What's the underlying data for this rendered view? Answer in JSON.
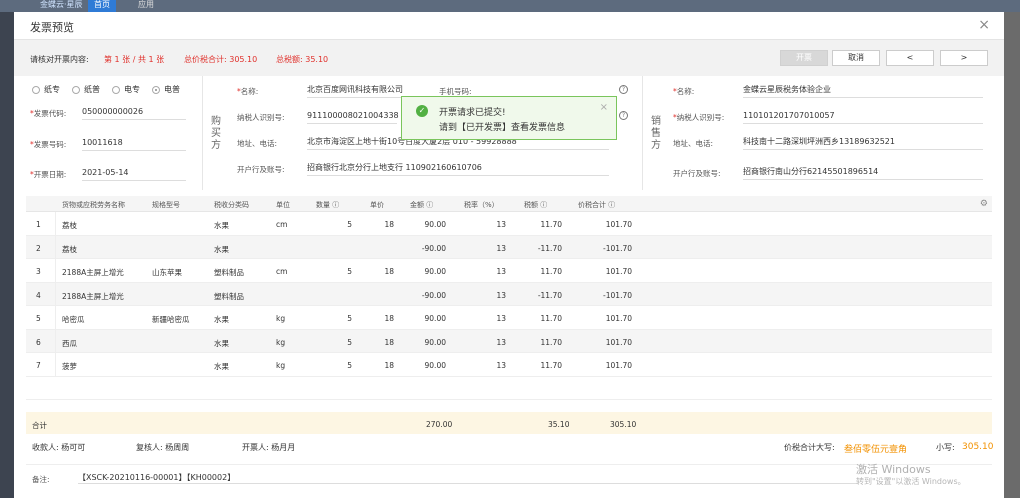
{
  "background": {
    "brand": "金蝶云·星辰",
    "tabs": [
      "首页",
      "应用"
    ]
  },
  "modal": {
    "title": "发票预览",
    "close_label": "×"
  },
  "toolbar": {
    "review_label": "请核对开票内容:",
    "page_info": "第 1 张 / 共 1 张",
    "total_with_tax_label": "总价税合计: 305.10",
    "total_tax_label": "总税额: 35.10",
    "issue_button": "开票",
    "cancel_button": "取消",
    "prev_button": "<",
    "next_button": ">"
  },
  "invoice_type": {
    "options": [
      "纸专",
      "纸普",
      "电专",
      "电普"
    ],
    "selected": "电普"
  },
  "invoice_info": {
    "code_label": "发票代码:",
    "code_value": "050000000026",
    "number_label": "发票号码:",
    "number_value": "10011618",
    "date_label": "开票日期:",
    "date_value": "2021-05-14"
  },
  "buyer": {
    "side_label": "购买方",
    "name_label": "名称:",
    "name_value": "北京百度网讯科技有限公司",
    "phone_label": "手机号码:",
    "tax_id_label": "纳税人识别号:",
    "tax_id_value": "911100008021004338",
    "address_label": "地址、电话:",
    "address_value": "北京市海淀区上地十街10号百度大厦2层 010 - 59928888",
    "bank_label": "开户行及账号:",
    "bank_value": "招商银行北京分行上地支行 110902160610706"
  },
  "seller": {
    "side_label": "销售方",
    "name_label": "名称:",
    "name_value": "金蝶云星辰税务体验企业",
    "tax_id_label": "纳税人识别号:",
    "tax_id_value": "110101201707010057",
    "address_label": "地址、电话:",
    "address_value": "科技南十二路深圳坪洲西乡13189632521",
    "bank_label": "开户行及账号:",
    "bank_value": "招商银行南山分行62145501896514"
  },
  "toast": {
    "line1": "开票请求已提交!",
    "line2": "请到【已开发票】查看发票信息",
    "close": "×"
  },
  "table": {
    "headers": [
      "货物或应税劳务名称",
      "规格型号",
      "税收分类码",
      "单位",
      "数量",
      "单价",
      "金额",
      "税率（%）",
      "税额",
      "价税合计"
    ],
    "rows": [
      {
        "no": "1",
        "name": "荔枝",
        "spec": "",
        "category": "水果",
        "unit": "cm",
        "qty": "5",
        "price": "18",
        "amount": "90.00",
        "rate": "13",
        "tax": "11.70",
        "total": "101.70"
      },
      {
        "no": "2",
        "name": "荔枝",
        "spec": "",
        "category": "水果",
        "unit": "",
        "qty": "",
        "price": "",
        "amount": "-90.00",
        "rate": "13",
        "tax": "-11.70",
        "total": "-101.70"
      },
      {
        "no": "3",
        "name": "2188A主屏上增光",
        "spec": "山东苹果",
        "category": "塑料制品",
        "unit": "cm",
        "qty": "5",
        "price": "18",
        "amount": "90.00",
        "rate": "13",
        "tax": "11.70",
        "total": "101.70"
      },
      {
        "no": "4",
        "name": "2188A主屏上增光",
        "spec": "",
        "category": "塑料制品",
        "unit": "",
        "qty": "",
        "price": "",
        "amount": "-90.00",
        "rate": "13",
        "tax": "-11.70",
        "total": "-101.70"
      },
      {
        "no": "5",
        "name": "哈密瓜",
        "spec": "新疆哈密瓜",
        "category": "水果",
        "unit": "kg",
        "qty": "5",
        "price": "18",
        "amount": "90.00",
        "rate": "13",
        "tax": "11.70",
        "total": "101.70"
      },
      {
        "no": "6",
        "name": "西瓜",
        "spec": "",
        "category": "水果",
        "unit": "kg",
        "qty": "5",
        "price": "18",
        "amount": "90.00",
        "rate": "13",
        "tax": "11.70",
        "total": "101.70"
      },
      {
        "no": "7",
        "name": "菠萝",
        "spec": "",
        "category": "水果",
        "unit": "kg",
        "qty": "5",
        "price": "18",
        "amount": "90.00",
        "rate": "13",
        "tax": "11.70",
        "total": "101.70"
      }
    ],
    "total_label": "合计",
    "total_amount": "270.00",
    "total_tax": "35.10",
    "total_sum": "305.10"
  },
  "signatures": {
    "payee": "收款人: 杨可可",
    "reviewer": "复核人: 杨周周",
    "drawer": "开票人: 杨月月",
    "capital_label": "价税合计大写:",
    "capital_value": "叁佰零伍元壹角",
    "small_label": "小写:",
    "small_value": "305.10"
  },
  "remark": {
    "label": "备注:",
    "value": "【XSCK-20210116-00001】【KH00002】"
  },
  "watermark": {
    "line1": "激活 Windows",
    "line2": "转到\"设置\"以激活 Windows。"
  },
  "colors": {
    "red": "#e0302b",
    "orange": "#f29100",
    "success": "#52b043"
  }
}
